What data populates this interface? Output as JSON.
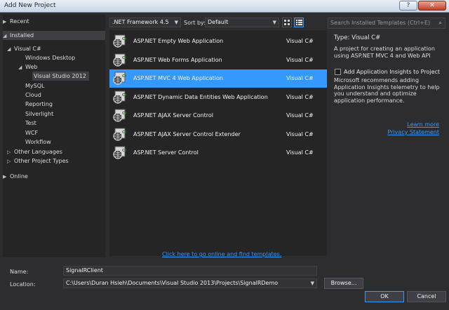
{
  "window": {
    "title": "Add New Project"
  },
  "tree": {
    "recent": "Recent",
    "installed": "Installed",
    "visual_cs": "Visual C#",
    "windows_desktop": "Windows Desktop",
    "web": "Web",
    "vs2012": "Visual Studio 2012",
    "mysql": "MySQL",
    "cloud": "Cloud",
    "reporting": "Reporting",
    "silverlight": "Silverlight",
    "test": "Test",
    "wcf": "WCF",
    "workflow": "Workflow",
    "other_languages": "Other Languages",
    "other_project_types": "Other Project Types",
    "online": "Online"
  },
  "toolbar": {
    "framework": ".NET Framework 4.5",
    "sort_label": "Sort by:",
    "sort_value": "Default",
    "search_placeholder": "Search Installed Templates (Ctrl+E)"
  },
  "templates": [
    {
      "name": "ASP.NET Empty Web Application",
      "lang": "Visual C#"
    },
    {
      "name": "ASP.NET Web Forms Application",
      "lang": "Visual C#"
    },
    {
      "name": "ASP.NET MVC 4 Web Application",
      "lang": "Visual C#"
    },
    {
      "name": "ASP.NET Dynamic Data Entities Web Application",
      "lang": "Visual C#"
    },
    {
      "name": "ASP.NET AJAX Server Control",
      "lang": "Visual C#"
    },
    {
      "name": "ASP.NET AJAX Server Control Extender",
      "lang": "Visual C#"
    },
    {
      "name": "ASP.NET Server Control",
      "lang": "Visual C#"
    }
  ],
  "info": {
    "type": "Type:  Visual C#",
    "description": "A project for creating an application using ASP.NET MVC 4 and Web API",
    "insights_label": "Add Application Insights to Project",
    "insights_desc": "Microsoft recommends adding Application Insights telemetry to help you understand and optimize application performance.",
    "learn_more": "Learn more",
    "privacy": "Privacy Statement"
  },
  "online_link": "Click here to go online and find templates.",
  "form": {
    "name_label": "Name:",
    "name_value": "SignalRClient",
    "location_label": "Location:",
    "location_value": "C:\\Users\\Duran Hsieh\\Documents\\Visual Studio 2013\\Projects\\SignalRDemo",
    "browse": "Browse...",
    "ok": "OK",
    "cancel": "Cancel"
  },
  "colors": {
    "accent": "#3399ff",
    "background": "#2d2d30",
    "panel": "#252526"
  }
}
